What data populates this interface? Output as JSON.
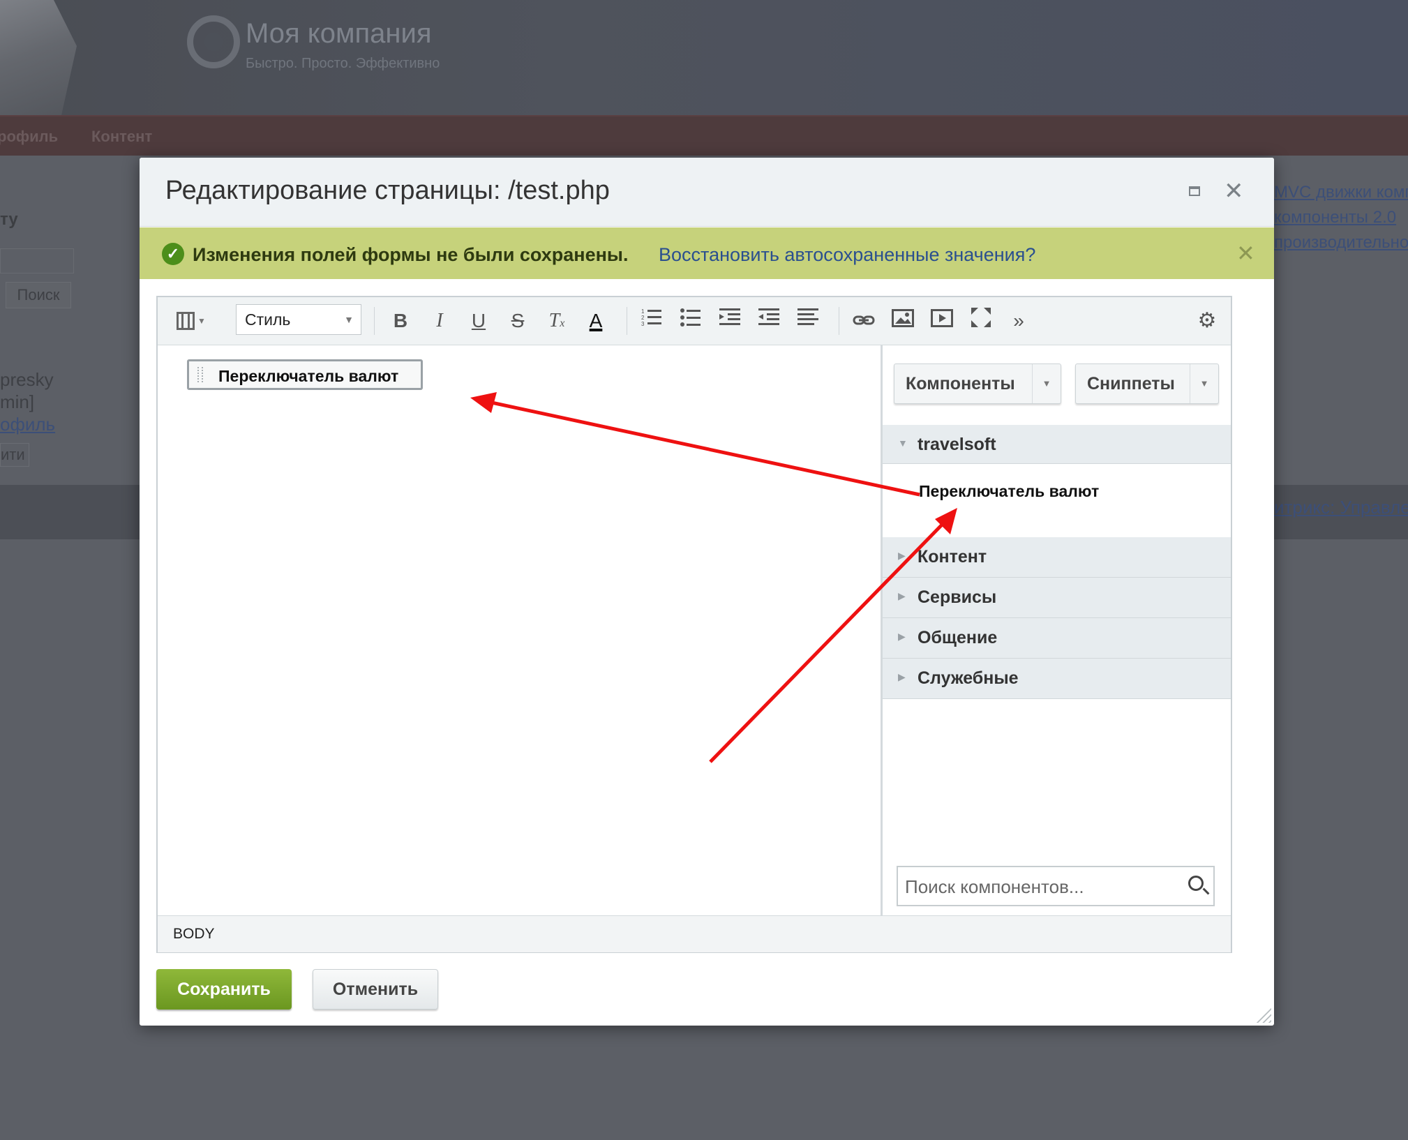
{
  "site": {
    "company_name": "Моя компания",
    "slogan": "Быстро. Просто. Эффективно",
    "nav": [
      "рофиль",
      "Контент"
    ],
    "left_panel": {
      "heading": "ту",
      "search_button": "Поиск",
      "user_line1": "presky",
      "user_line2": "min]",
      "profile_link": "офиль",
      "logout_button": "ити"
    },
    "right_links": [
      "MVC движки компо",
      "компоненты 2.0",
      "производительнос"
    ],
    "footer_link": "итрикс: Управле"
  },
  "dialog": {
    "title": "Редактирование страницы: /test.php",
    "notice": {
      "text": "Изменения полей формы не были сохранены.",
      "restore_link": "Восстановить автосохраненные значения?"
    },
    "toolbar": {
      "style_select": "Стиль",
      "bold": "B",
      "italic": "I",
      "underline": "U",
      "strike": "S",
      "clear_format": "T",
      "font_color": "A",
      "more": "»",
      "icons": [
        "view-mode-icon",
        "ordered-list-icon",
        "unordered-list-icon",
        "outdent-icon",
        "indent-icon",
        "align-icon",
        "link-icon",
        "image-icon",
        "video-icon",
        "fullscreen-icon",
        "more-icon",
        "settings-icon"
      ]
    },
    "content_component": "Переключатель валют",
    "sidebar": {
      "components_button": "Компоненты",
      "snippets_button": "Сниппеты",
      "groups": [
        {
          "name": "travelsoft",
          "expanded": true,
          "items": [
            "Переключатель валют"
          ]
        },
        {
          "name": "Контент",
          "expanded": false
        },
        {
          "name": "Сервисы",
          "expanded": false
        },
        {
          "name": "Общение",
          "expanded": false
        },
        {
          "name": "Служебные",
          "expanded": false
        }
      ],
      "search_placeholder": "Поиск компонентов..."
    },
    "statusbar": "BODY",
    "save_button": "Сохранить",
    "cancel_button": "Отменить"
  },
  "colors": {
    "notice_bg": "#c6d27b",
    "save_green": "#7aa62a",
    "arrow_red": "#ee1111",
    "link_blue": "#2a4f8f"
  }
}
